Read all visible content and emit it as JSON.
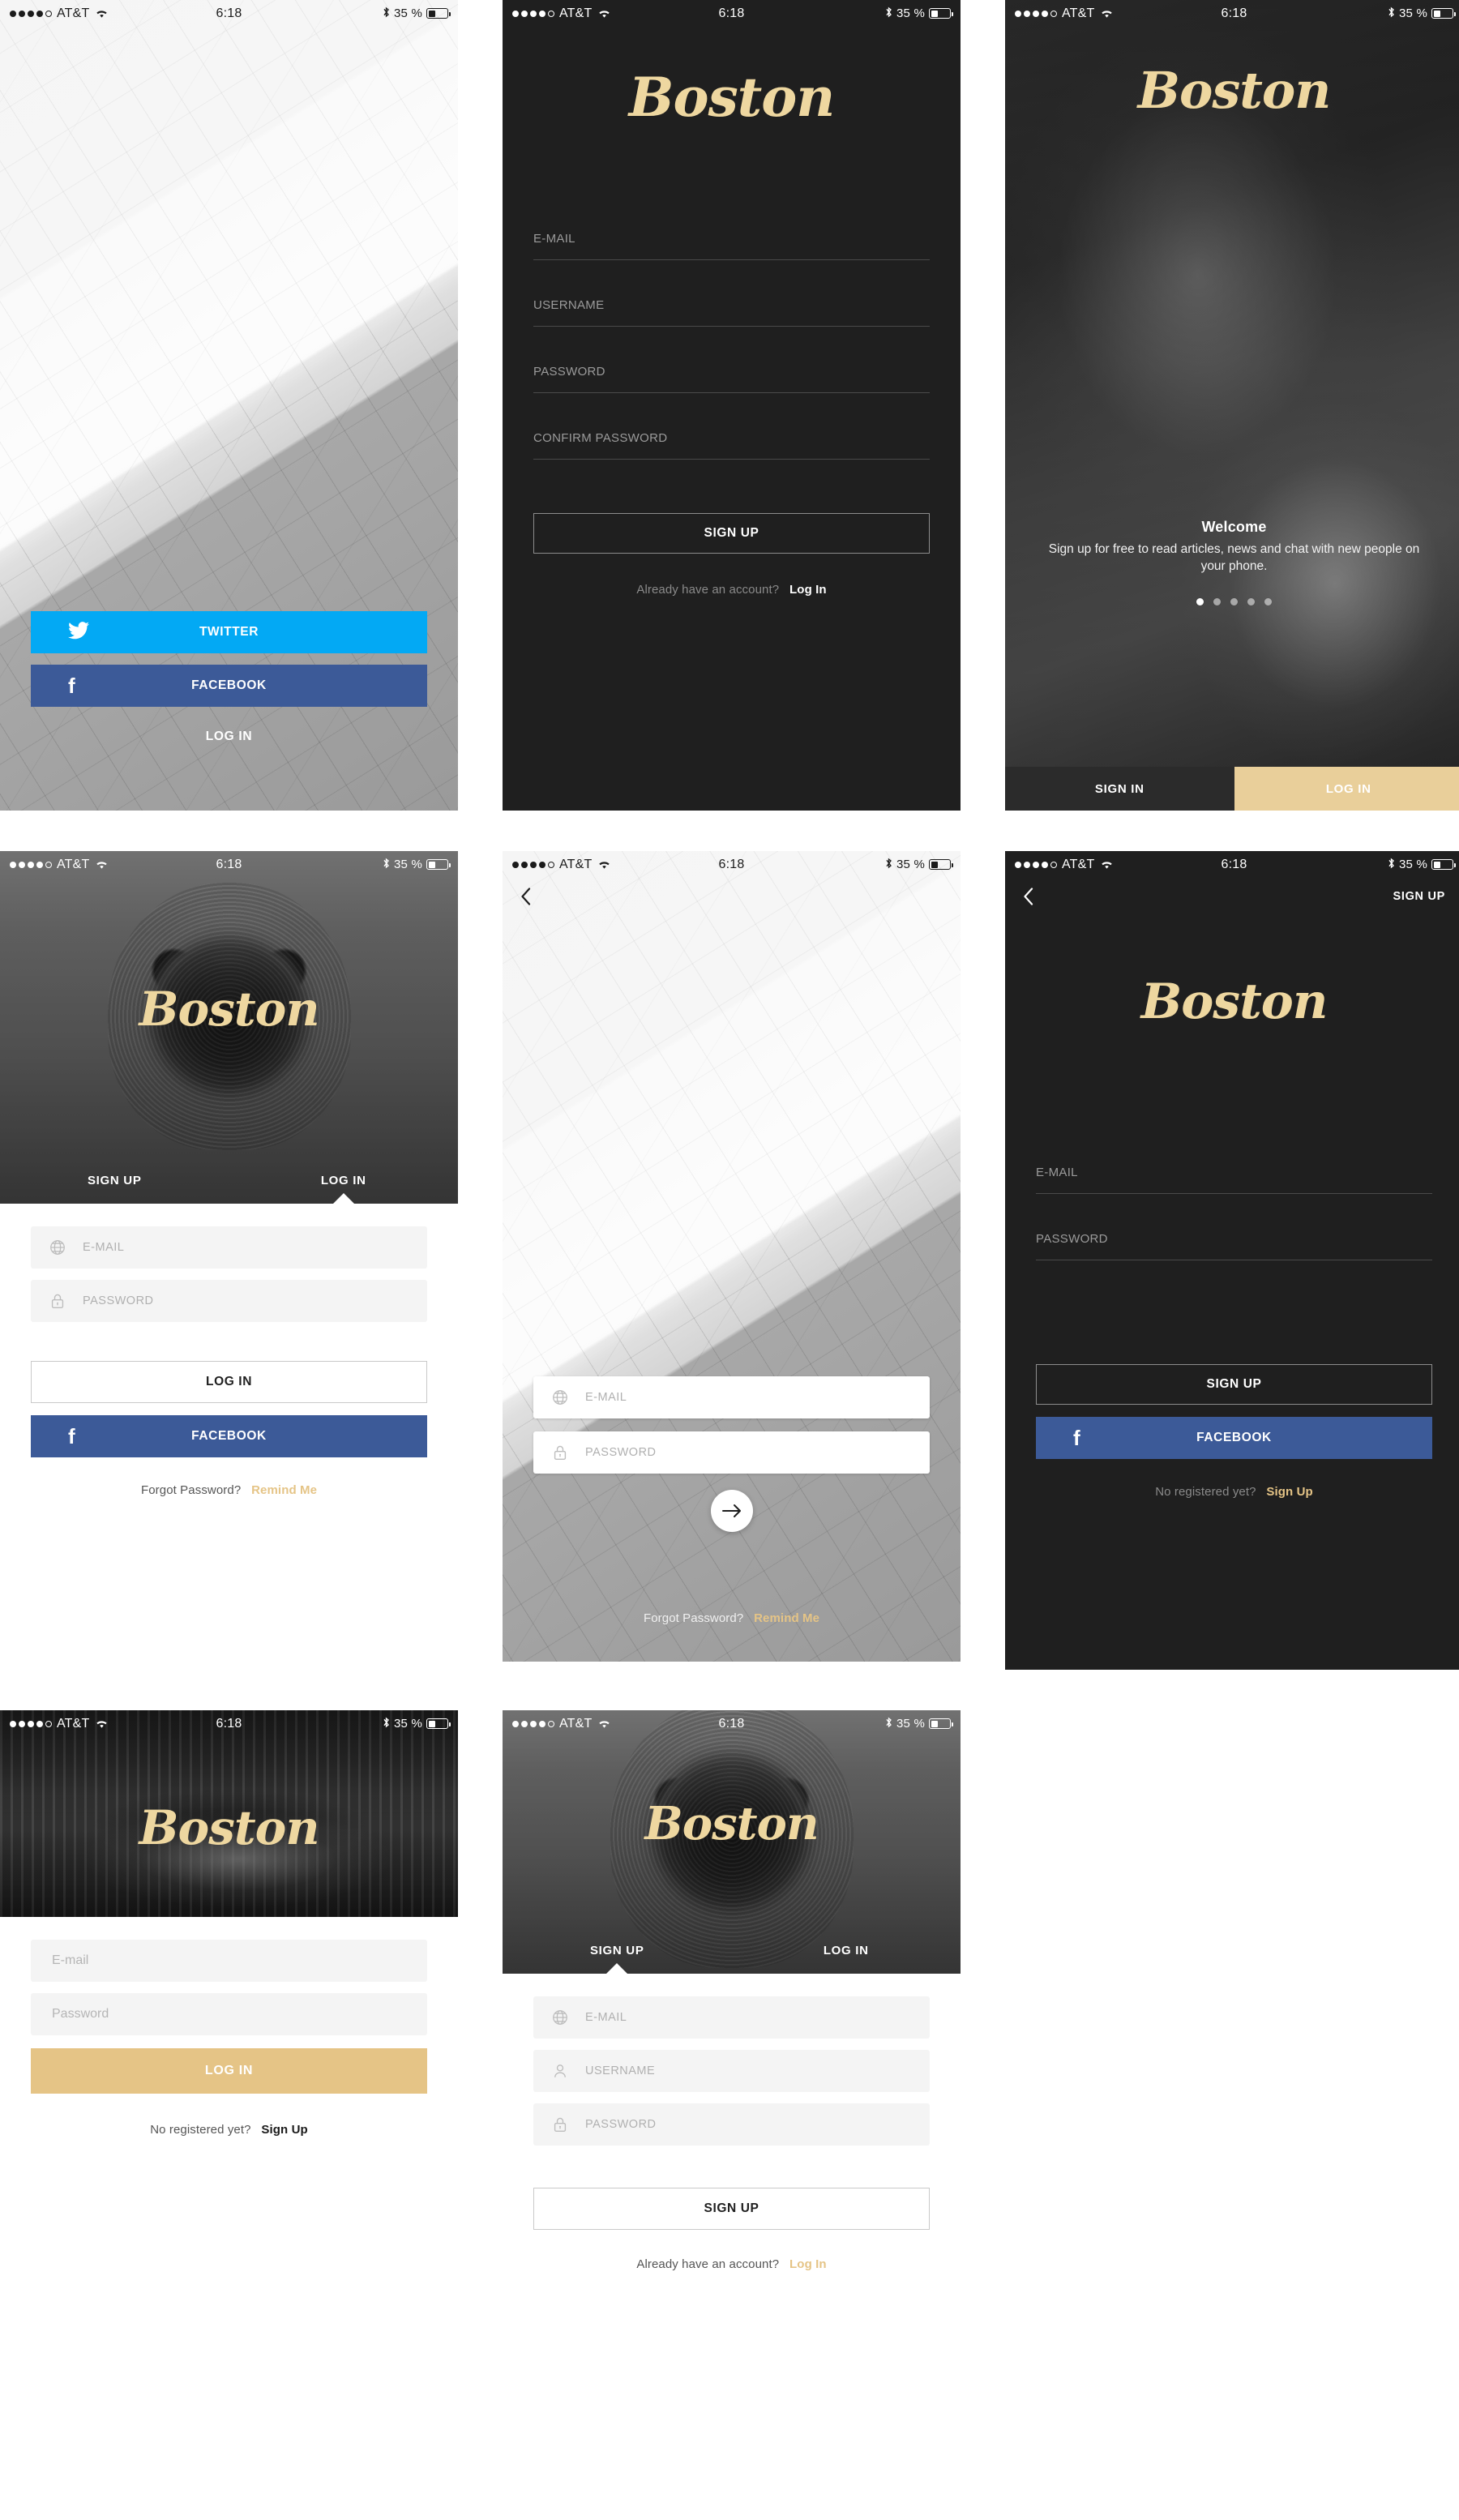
{
  "brand": {
    "name": "Boston",
    "gold": "#e5c486",
    "facebook_blue": "#3c5a98",
    "twitter_blue": "#03a9f4",
    "dark_bg": "#1f1f1f"
  },
  "status_bar": {
    "carrier": "AT&T",
    "time": "6:18",
    "battery": "35 %"
  },
  "screens": {
    "social_login": {
      "twitter_label": "TWITTER",
      "facebook_label": "FACEBOOK",
      "login_label": "LOG IN",
      "twitter_icon": "twitter-bird-icon",
      "facebook_icon": "facebook-f-icon"
    },
    "dark_signup": {
      "fields": [
        {
          "label": "E-MAIL"
        },
        {
          "label": "USERNAME"
        },
        {
          "label": "PASSWORD"
        },
        {
          "label": "CONFIRM PASSWORD"
        }
      ],
      "submit_label": "SIGN UP",
      "footer_question": "Already have an account?",
      "footer_action": "Log In"
    },
    "welcome": {
      "title": "Welcome",
      "subtitle": "Sign up for free to read articles, news and chat with new people on your phone.",
      "dots_total": 5,
      "dots_active_index": 0,
      "primary_label": "SIGN IN",
      "secondary_label": "LOG IN"
    },
    "tabbed_login": {
      "tab_signup": "SIGN UP",
      "tab_login": "LOG IN",
      "active_tab": "LOG IN",
      "email_placeholder": "E-MAIL",
      "password_placeholder": "PASSWORD",
      "login_label": "LOG IN",
      "facebook_label": "FACEBOOK",
      "footer_question": "Forgot Password?",
      "footer_action": "Remind Me"
    },
    "photo_login": {
      "back_icon": "chevron-left-icon",
      "email_placeholder": "E-MAIL",
      "password_placeholder": "PASSWORD",
      "submit_icon": "arrow-right-icon",
      "footer_question": "Forgot Password?",
      "footer_action": "Remind Me"
    },
    "dark_login": {
      "back_icon": "chevron-left-icon",
      "nav_action": "SIGN UP",
      "email_placeholder": "E-MAIL",
      "password_placeholder": "PASSWORD",
      "signup_label": "SIGN UP",
      "facebook_label": "FACEBOOK",
      "footer_question": "No registered yet?",
      "footer_action": "Sign Up"
    },
    "gold_login": {
      "email_placeholder": "E-mail",
      "password_placeholder": "Password",
      "login_label": "LOG IN",
      "footer_question": "No registered yet?",
      "footer_action": "Sign Up"
    },
    "tabbed_signup": {
      "tab_signup": "SIGN UP",
      "tab_login": "LOG IN",
      "active_tab": "SIGN UP",
      "email_placeholder": "E-MAIL",
      "username_placeholder": "USERNAME",
      "password_placeholder": "PASSWORD",
      "submit_label": "SIGN UP",
      "footer_question": "Already have an account?",
      "footer_action": "Log In"
    }
  }
}
